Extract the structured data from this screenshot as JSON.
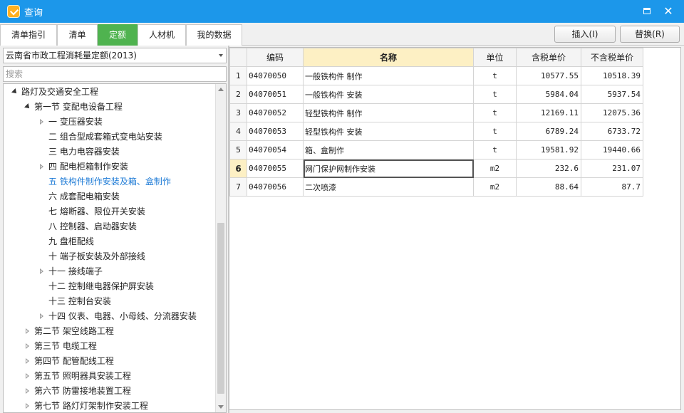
{
  "window": {
    "title": "查询"
  },
  "tabs": [
    {
      "label": "清单指引"
    },
    {
      "label": "清单"
    },
    {
      "label": "定额"
    },
    {
      "label": "人材机"
    },
    {
      "label": "我的数据"
    }
  ],
  "actions": {
    "insert_label": "插入(I)",
    "replace_label": "替换(R)"
  },
  "left": {
    "library_selected": "云南省市政工程消耗量定额(2013)",
    "search_placeholder": "搜索",
    "tree": [
      {
        "label": "路灯及交通安全工程",
        "state": "open",
        "level": 0
      },
      {
        "label": "第一节  变配电设备工程",
        "state": "open",
        "level": 1
      },
      {
        "label": "一  变压器安装",
        "state": "closed",
        "level": 2
      },
      {
        "label": "二  组合型成套箱式变电站安装",
        "state": "leaf",
        "level": 2
      },
      {
        "label": "三  电力电容器安装",
        "state": "leaf",
        "level": 2
      },
      {
        "label": "四  配电柜箱制作安装",
        "state": "closed",
        "level": 2
      },
      {
        "label": "五  铁构件制作安装及箱、盒制作",
        "state": "leaf",
        "level": 2,
        "selected": true
      },
      {
        "label": "六  成套配电箱安装",
        "state": "leaf",
        "level": 2
      },
      {
        "label": "七  熔断器、限位开关安装",
        "state": "leaf",
        "level": 2
      },
      {
        "label": "八  控制器、启动器安装",
        "state": "leaf",
        "level": 2
      },
      {
        "label": "九  盘柜配线",
        "state": "leaf",
        "level": 2
      },
      {
        "label": "十  端子板安装及外部接线",
        "state": "leaf",
        "level": 2
      },
      {
        "label": "十一  接线端子",
        "state": "closed",
        "level": 2
      },
      {
        "label": "十二  控制继电器保护屏安装",
        "state": "leaf",
        "level": 2
      },
      {
        "label": "十三  控制台安装",
        "state": "leaf",
        "level": 2
      },
      {
        "label": "十四  仪表、电器、小母线、分流器安装",
        "state": "closed",
        "level": 2
      },
      {
        "label": "第二节  架空线路工程",
        "state": "closed",
        "level": 1
      },
      {
        "label": "第三节  电缆工程",
        "state": "closed",
        "level": 1
      },
      {
        "label": "第四节  配管配线工程",
        "state": "closed",
        "level": 1
      },
      {
        "label": "第五节  照明器具安装工程",
        "state": "closed",
        "level": 1
      },
      {
        "label": "第六节  防雷接地装置工程",
        "state": "closed",
        "level": 1
      },
      {
        "label": "第七节  路灯灯架制作安装工程",
        "state": "closed",
        "level": 1
      }
    ]
  },
  "grid": {
    "columns": [
      "",
      "编码",
      "名称",
      "单位",
      "含税单价",
      "不含税单价"
    ],
    "current_row": 5,
    "rows": [
      {
        "no": "1",
        "code": "04070050",
        "name": "一般铁构件 制作",
        "unit": "t",
        "price_tax": "10577.55",
        "price_notax": "10518.39"
      },
      {
        "no": "2",
        "code": "04070051",
        "name": "一般铁构件 安装",
        "unit": "t",
        "price_tax": "5984.04",
        "price_notax": "5937.54"
      },
      {
        "no": "3",
        "code": "04070052",
        "name": "轻型铁构件 制作",
        "unit": "t",
        "price_tax": "12169.11",
        "price_notax": "12075.36"
      },
      {
        "no": "4",
        "code": "04070053",
        "name": "轻型铁构件 安装",
        "unit": "t",
        "price_tax": "6789.24",
        "price_notax": "6733.72"
      },
      {
        "no": "5",
        "code": "04070054",
        "name": "箱、盒制作",
        "unit": "t",
        "price_tax": "19581.92",
        "price_notax": "19440.66"
      },
      {
        "no": "6",
        "code": "04070055",
        "name": "网门保护网制作安装",
        "unit": "m2",
        "price_tax": "232.6",
        "price_notax": "231.07"
      },
      {
        "no": "7",
        "code": "04070056",
        "name": "二次喷漆",
        "unit": "m2",
        "price_tax": "88.64",
        "price_notax": "87.7"
      }
    ]
  },
  "colors": {
    "titlebar": "#1c97ea",
    "active_tab": "#4fb34f",
    "selected_tree_text": "#1e7bd6",
    "header_highlight": "#fdf0c4"
  },
  "icons": [
    "app-icon",
    "maximize-icon",
    "close-icon",
    "dropdown-arrow-icon",
    "expand-arrow-icon",
    "collapse-arrow-icon"
  ]
}
